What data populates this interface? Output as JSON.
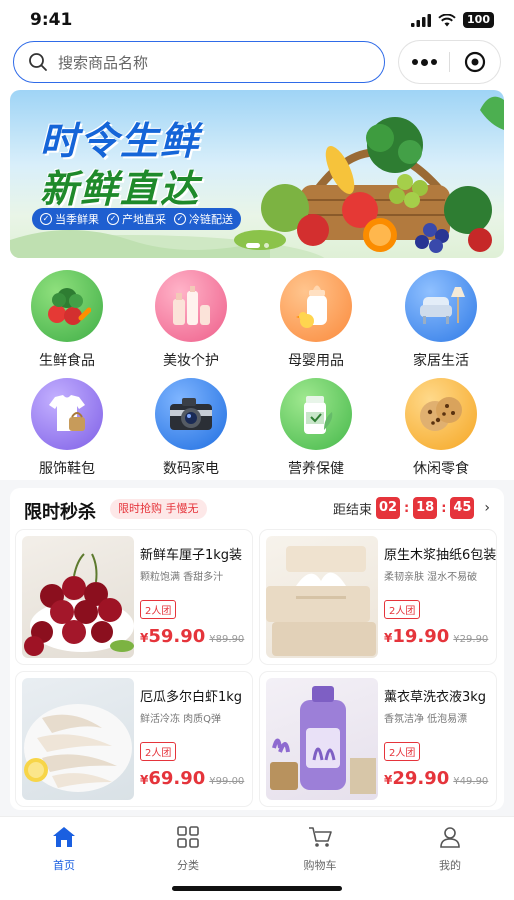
{
  "status_bar": {
    "time": "9:41",
    "battery": "100"
  },
  "search": {
    "placeholder": "搜索商品名称"
  },
  "banner": {
    "title_line1": "时令生鲜",
    "title_line2": "新鲜直达",
    "tags": [
      "当季鲜果",
      "产地直采",
      "冷链配送"
    ]
  },
  "categories": [
    {
      "label": "生鲜食品",
      "icon": "vegetables-icon",
      "color": "#5cc65a"
    },
    {
      "label": "美妆个护",
      "icon": "cosmetics-icon",
      "color": "#f47aa0"
    },
    {
      "label": "母婴用品",
      "icon": "baby-bottle-icon",
      "color": "#ff9c5a"
    },
    {
      "label": "家居生活",
      "icon": "armchair-icon",
      "color": "#4a8ff0"
    },
    {
      "label": "服饰鞋包",
      "icon": "clothing-icon",
      "color": "#9a7cf0"
    },
    {
      "label": "数码家电",
      "icon": "camera-icon",
      "color": "#3a86ee"
    },
    {
      "label": "营养保健",
      "icon": "supplement-icon",
      "color": "#5cc65a"
    },
    {
      "label": "休闲零食",
      "icon": "cookie-icon",
      "color": "#ffb03a"
    }
  ],
  "flash_sale": {
    "title": "限时秒杀",
    "badge": "限时抢购 手慢无",
    "countdown_label": "距结束",
    "hours": "02",
    "minutes": "18",
    "seconds": "45",
    "products": [
      {
        "name": "新鲜车厘子1kg装",
        "desc": "颗粒饱满 香甜多汁",
        "group": "2人团",
        "yen": "¥",
        "price": "59.90",
        "original": "¥89.90"
      },
      {
        "name": "原生木浆抽纸6包装",
        "desc": "柔韧亲肤 湿水不易破",
        "group": "2人团",
        "yen": "¥",
        "price": "19.90",
        "original": "¥29.90"
      },
      {
        "name": "厄瓜多尔白虾1kg",
        "desc": "鲜活冷冻 肉质Q弹",
        "group": "2人团",
        "yen": "¥",
        "price": "69.90",
        "original": "¥99.00"
      },
      {
        "name": "薰衣草洗衣液3kg",
        "desc": "香氛洁净 低泡易漂",
        "group": "2人团",
        "yen": "¥",
        "price": "29.90",
        "original": "¥49.90"
      }
    ]
  },
  "tabbar": [
    {
      "label": "首页",
      "active": true
    },
    {
      "label": "分类"
    },
    {
      "label": "购物车"
    },
    {
      "label": "我的"
    }
  ],
  "colors": {
    "accent": "#1a5fe0",
    "price_red": "#e5343b"
  }
}
